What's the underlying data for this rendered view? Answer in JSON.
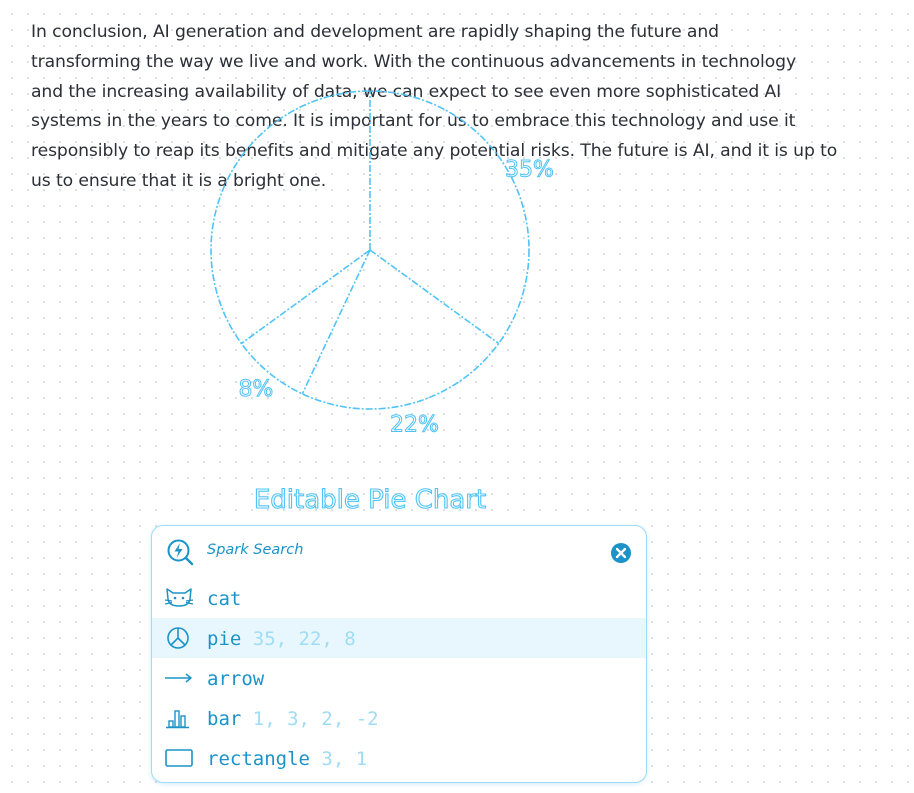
{
  "paragraph": {
    "line1": "In conclusion, AI generation and development are rapidly shaping the future and",
    "line2": "transforming the way we live and work. With the continuous advancements in technology",
    "line3": "and the increasing availability of data, we can expect to see even more sophisticated AI",
    "line4": "systems in the years to come. It is important for us to embrace this technology and use it",
    "line5": "responsibly to reap its benefits and mitigate any potential risks. The future is AI, and it is up to",
    "line6": "us to ensure that it is a bright one."
  },
  "chart_data": {
    "type": "pie",
    "title": "Editable Pie Chart",
    "values": [
      35,
      22,
      8
    ],
    "labels": [
      "35%",
      "22%",
      "8%"
    ],
    "color": "#4fc3f7"
  },
  "spark_search": {
    "title": "Spark Search",
    "items": [
      {
        "name": "cat",
        "args": "",
        "icon": "cat-icon"
      },
      {
        "name": "pie",
        "args": "35, 22, 8",
        "icon": "pie-chart-icon",
        "selected": true
      },
      {
        "name": "arrow",
        "args": "",
        "icon": "arrow-icon"
      },
      {
        "name": "bar",
        "args": "1, 3, 2, -2",
        "icon": "bar-chart-icon"
      },
      {
        "name": "rectangle",
        "args": "3, 1",
        "icon": "rectangle-icon"
      }
    ]
  },
  "colors": {
    "accent": "#1b93c9",
    "accent_light": "#9fdcf5",
    "chart": "#4fc3f7",
    "text": "#2b2f36",
    "selected_bg": "#e8f7fe"
  }
}
